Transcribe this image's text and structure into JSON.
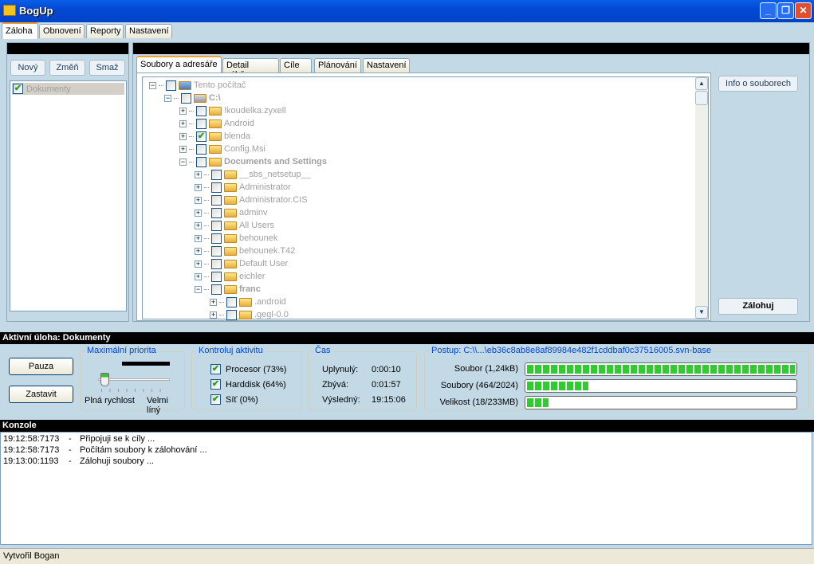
{
  "app": {
    "title": "BogUp"
  },
  "main_tabs": [
    "Záloha",
    "Obnovení",
    "Reporty",
    "Nastavení"
  ],
  "jobs": {
    "buttons": {
      "new": "Nový",
      "edit": "Změň",
      "delete": "Smaž"
    },
    "items": [
      {
        "label": "Dokumenty",
        "checked": true
      }
    ]
  },
  "job_tabs": [
    "Soubory a adresáře",
    "Detail výběru",
    "Cíle",
    "Plánování",
    "Nastavení"
  ],
  "tree": [
    {
      "level": 0,
      "label": "Tento počítač",
      "icon": "computer",
      "exp": "-",
      "bold": false,
      "checked": false
    },
    {
      "level": 1,
      "label": "C:\\",
      "icon": "drive",
      "exp": "-",
      "bold": true,
      "checked": false
    },
    {
      "level": 2,
      "label": "!koudelka.zyxell",
      "icon": "folder",
      "exp": "+",
      "bold": false,
      "checked": false
    },
    {
      "level": 2,
      "label": "Android",
      "icon": "folder",
      "exp": "+",
      "bold": false,
      "checked": false
    },
    {
      "level": 2,
      "label": "blenda",
      "icon": "folder",
      "exp": "+",
      "bold": false,
      "checked": true
    },
    {
      "level": 2,
      "label": "Config.Msi",
      "icon": "folder",
      "exp": "+",
      "bold": false,
      "checked": false
    },
    {
      "level": 2,
      "label": "Documents and Settings",
      "icon": "folder",
      "exp": "-",
      "bold": true,
      "checked": false
    },
    {
      "level": 3,
      "label": "__sbs_netsetup__",
      "icon": "folder",
      "exp": "+",
      "bold": false,
      "checked": false
    },
    {
      "level": 3,
      "label": "Administrator",
      "icon": "folder",
      "exp": "+",
      "bold": false,
      "checked": false
    },
    {
      "level": 3,
      "label": "Administrator.CIS",
      "icon": "folder",
      "exp": "+",
      "bold": false,
      "checked": false
    },
    {
      "level": 3,
      "label": "adminv",
      "icon": "folder",
      "exp": "+",
      "bold": false,
      "checked": false
    },
    {
      "level": 3,
      "label": "All Users",
      "icon": "folder",
      "exp": "+",
      "bold": false,
      "checked": false
    },
    {
      "level": 3,
      "label": "behounek",
      "icon": "folder",
      "exp": "+",
      "bold": false,
      "checked": false
    },
    {
      "level": 3,
      "label": "behounek.T42",
      "icon": "folder",
      "exp": "+",
      "bold": false,
      "checked": false
    },
    {
      "level": 3,
      "label": "Default User",
      "icon": "folder",
      "exp": "+",
      "bold": false,
      "checked": false
    },
    {
      "level": 3,
      "label": "eichler",
      "icon": "folder",
      "exp": "+",
      "bold": false,
      "checked": false
    },
    {
      "level": 3,
      "label": "franc",
      "icon": "folder",
      "exp": "-",
      "bold": true,
      "checked": false
    },
    {
      "level": 4,
      "label": ".android",
      "icon": "folder",
      "exp": "+",
      "bold": false,
      "checked": false
    },
    {
      "level": 4,
      "label": ".gegl-0.0",
      "icon": "folder",
      "exp": "+",
      "bold": false,
      "checked": false
    }
  ],
  "side_buttons": {
    "info": "Info o souborech",
    "backup": "Zálohuj"
  },
  "active": {
    "title": "Aktivní úloha: Dokumenty",
    "pause": "Pauza",
    "stop": "Zastavit",
    "priority": {
      "label": "Maximální priorita",
      "min": "Plná rychlost",
      "max": "Velmi líný",
      "value_fraction": 0.1
    },
    "activity": {
      "label": "Kontroluj aktivitu",
      "items": [
        {
          "label": "Procesor (73%)",
          "checked": true
        },
        {
          "label": "Harddisk (64%)",
          "checked": true
        },
        {
          "label": "Síť (0%)",
          "checked": true
        }
      ]
    },
    "time": {
      "label": "Čas",
      "rows": [
        {
          "k": "Uplynulý:",
          "v": "0:00:10"
        },
        {
          "k": "Zbývá:",
          "v": "0:01:57"
        },
        {
          "k": "Výsledný:",
          "v": "19:15:06"
        }
      ]
    },
    "progress": {
      "label": "Postup: C:\\\\...\\eb36c8ab8e8af89984e482f1cddbaf0c37516005.svn-base",
      "bars": [
        {
          "label": "Soubor (1,24kB)",
          "percent": 100
        },
        {
          "label": "Soubory (464/2024)",
          "percent": 23
        },
        {
          "label": "Velikost (18/233MB)",
          "percent": 8
        }
      ]
    }
  },
  "console": {
    "title": "Konzole",
    "lines": [
      {
        "time": "19:12:58:7173",
        "sep": "-",
        "msg": "Připojuji se k cíly ..."
      },
      {
        "time": "19:12:58:7173",
        "sep": "-",
        "msg": "Počítám soubory k zálohování ..."
      },
      {
        "time": "19:13:00:1193",
        "sep": "-",
        "msg": "Zálohuji soubory ..."
      }
    ]
  },
  "status": "Vytvořil Bogan"
}
